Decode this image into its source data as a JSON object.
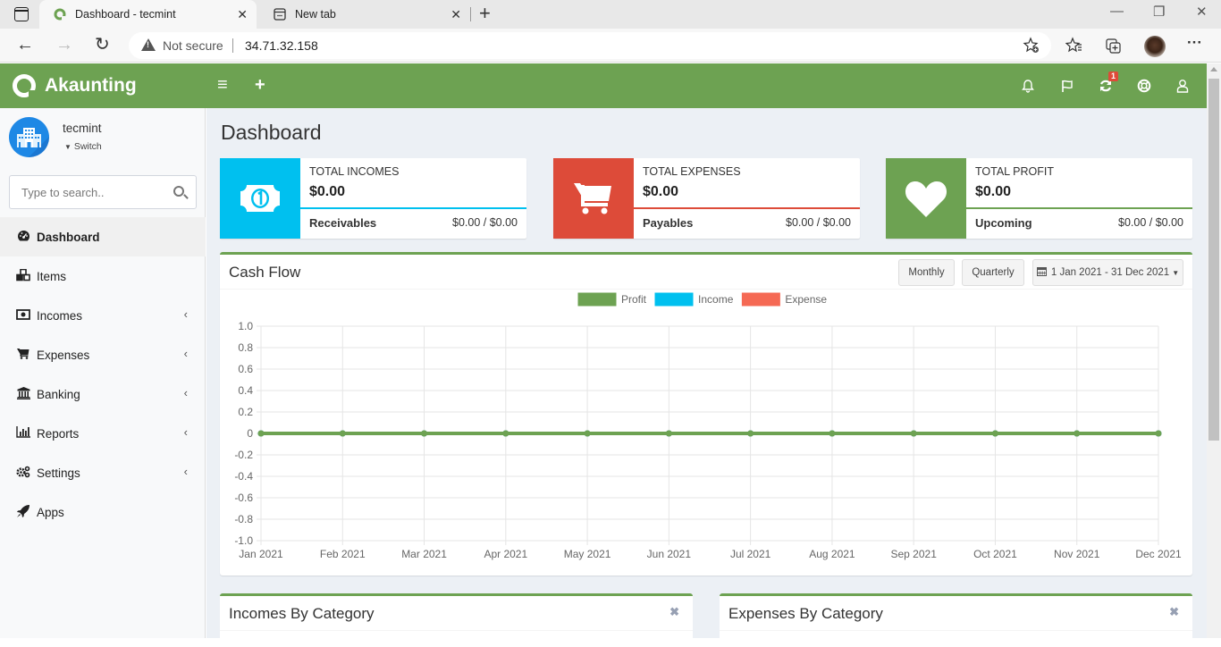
{
  "browser": {
    "tabs": [
      {
        "title": "Dashboard - tecmint",
        "active": true
      },
      {
        "title": "New tab",
        "active": false
      }
    ],
    "security_label": "Not secure",
    "url": "34.71.32.158",
    "tab_close_glyph": "✕",
    "new_tab_glyph": "+",
    "minimize_glyph": "—",
    "restore_glyph": "❐",
    "close_glyph": "✕",
    "back_glyph": "←",
    "forward_glyph": "→",
    "reload_glyph": "↻",
    "more_glyph": "···"
  },
  "app": {
    "brand": "Akaunting",
    "menu_toggle_glyph": "≡",
    "add_glyph": "+",
    "notifications_badge": "1",
    "accent_color": "#6da252"
  },
  "sidebar": {
    "company": "tecmint",
    "switch_label": "Switch",
    "search_placeholder": "Type to search..",
    "items": [
      {
        "label": "Dashboard",
        "icon": "dashboard-icon",
        "glyph": "◕",
        "active": true,
        "has_submenu": false
      },
      {
        "label": "Items",
        "icon": "cubes-icon",
        "glyph": "❖",
        "active": false,
        "has_submenu": false
      },
      {
        "label": "Incomes",
        "icon": "money-icon",
        "glyph": "▣",
        "active": false,
        "has_submenu": true
      },
      {
        "label": "Expenses",
        "icon": "shopping-cart-icon",
        "glyph": "🛒",
        "active": false,
        "has_submenu": true
      },
      {
        "label": "Banking",
        "icon": "university-icon",
        "glyph": "🏛",
        "active": false,
        "has_submenu": true
      },
      {
        "label": "Reports",
        "icon": "bar-chart-icon",
        "glyph": "📊",
        "active": false,
        "has_submenu": true
      },
      {
        "label": "Settings",
        "icon": "gears-icon",
        "glyph": "⚙",
        "active": false,
        "has_submenu": true
      },
      {
        "label": "Apps",
        "icon": "rocket-icon",
        "glyph": "🚀",
        "active": false,
        "has_submenu": false
      }
    ],
    "chevron_glyph": "‹"
  },
  "page": {
    "title": "Dashboard"
  },
  "info_boxes": [
    {
      "label": "TOTAL INCOMES",
      "value": "$0.00",
      "sub_label": "Receivables",
      "sub_value": "$0.00 / $0.00",
      "color": "#00c0ef",
      "icon": "money-bill-icon"
    },
    {
      "label": "TOTAL EXPENSES",
      "value": "$0.00",
      "sub_label": "Payables",
      "sub_value": "$0.00 / $0.00",
      "color": "#dd4b39",
      "icon": "shopping-cart-icon"
    },
    {
      "label": "TOTAL PROFIT",
      "value": "$0.00",
      "sub_label": "Upcoming",
      "sub_value": "$0.00 / $0.00",
      "color": "#6da252",
      "icon": "heart-icon"
    }
  ],
  "cashflow": {
    "title": "Cash Flow",
    "monthly_label": "Monthly",
    "quarterly_label": "Quarterly",
    "date_range": "1 Jan 2021 - 31 Dec 2021"
  },
  "chart_data": {
    "type": "line",
    "title": "Cash Flow",
    "xlabel": "",
    "ylabel": "",
    "categories": [
      "Jan 2021",
      "Feb 2021",
      "Mar 2021",
      "Apr 2021",
      "May 2021",
      "Jun 2021",
      "Jul 2021",
      "Aug 2021",
      "Sep 2021",
      "Oct 2021",
      "Nov 2021",
      "Dec 2021"
    ],
    "series": [
      {
        "name": "Profit",
        "color": "#6da252",
        "values": [
          0,
          0,
          0,
          0,
          0,
          0,
          0,
          0,
          0,
          0,
          0,
          0
        ]
      },
      {
        "name": "Income",
        "color": "#00c0ef",
        "values": [
          0,
          0,
          0,
          0,
          0,
          0,
          0,
          0,
          0,
          0,
          0,
          0
        ]
      },
      {
        "name": "Expense",
        "color": "#f56954",
        "values": [
          0,
          0,
          0,
          0,
          0,
          0,
          0,
          0,
          0,
          0,
          0,
          0
        ]
      }
    ],
    "yticks": [
      "1.0",
      "0.8",
      "0.6",
      "0.4",
      "0.2",
      "0",
      "-0.2",
      "-0.4",
      "-0.6",
      "-0.8",
      "-1.0"
    ],
    "ylim": [
      -1.0,
      1.0
    ],
    "grid": true,
    "legend": "top-center"
  },
  "category_boxes": [
    {
      "title": "Incomes By Category",
      "close_glyph": "✖"
    },
    {
      "title": "Expenses By Category",
      "close_glyph": "✖"
    }
  ]
}
